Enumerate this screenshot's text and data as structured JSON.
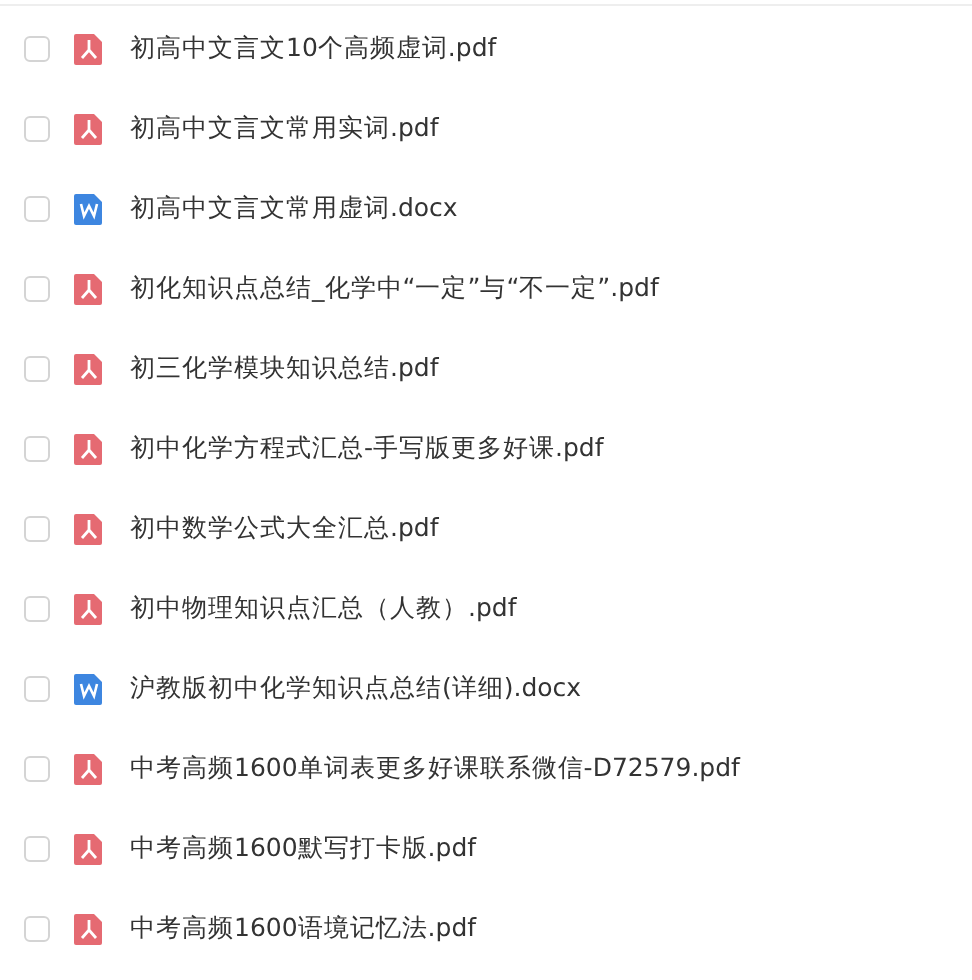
{
  "files": [
    {
      "name": "初高中文言文10个高频虚词.pdf",
      "kind": "pdf",
      "checked": false
    },
    {
      "name": "初高中文言文常用实词.pdf",
      "kind": "pdf",
      "checked": false
    },
    {
      "name": "初高中文言文常用虚词.docx",
      "kind": "docx",
      "checked": false
    },
    {
      "name": "初化知识点总结_化学中“一定”与“不一定”.pdf",
      "kind": "pdf",
      "checked": false
    },
    {
      "name": "初三化学模块知识总结.pdf",
      "kind": "pdf",
      "checked": false
    },
    {
      "name": "初中化学方程式汇总-手写版更多好课.pdf",
      "kind": "pdf",
      "checked": false
    },
    {
      "name": "初中数学公式大全汇总.pdf",
      "kind": "pdf",
      "checked": false
    },
    {
      "name": "初中物理知识点汇总（人教）.pdf",
      "kind": "pdf",
      "checked": false
    },
    {
      "name": "沪教版初中化学知识点总结(详细).docx",
      "kind": "docx",
      "checked": false
    },
    {
      "name": "中考高频1600单词表更多好课联系微信-D72579.pdf",
      "kind": "pdf",
      "checked": false
    },
    {
      "name": "中考高频1600默写打卡版.pdf",
      "kind": "pdf",
      "checked": false
    },
    {
      "name": "中考高频1600语境记忆法.pdf",
      "kind": "pdf",
      "checked": false
    }
  ]
}
